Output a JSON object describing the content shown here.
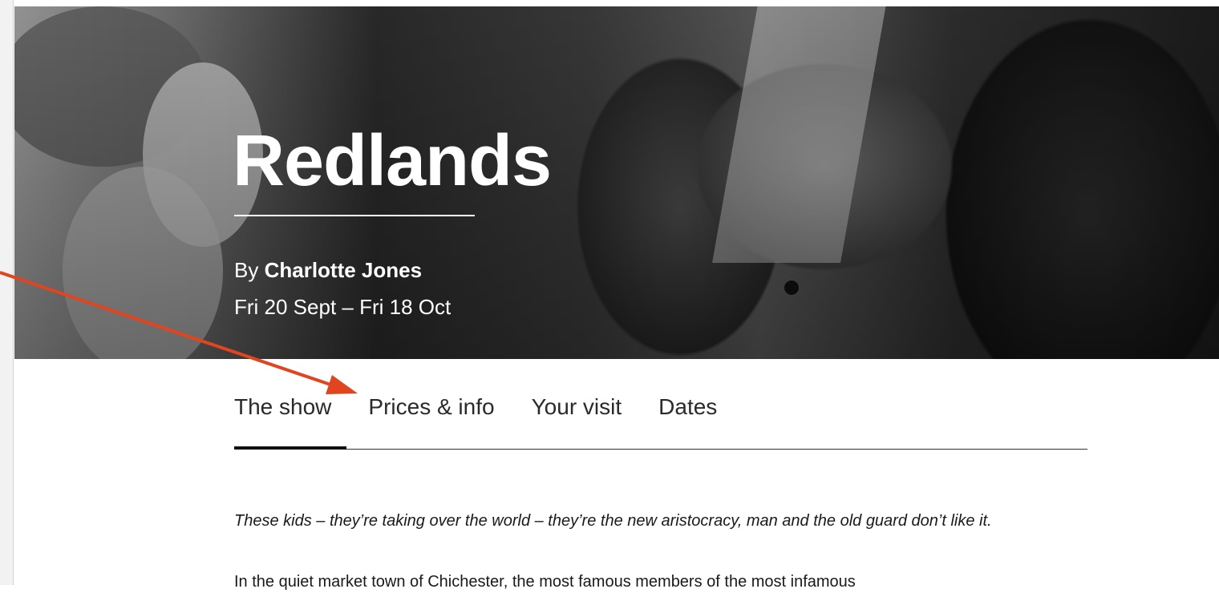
{
  "show": {
    "title": "Redlands",
    "by_prefix": "By ",
    "author": "Charlotte Jones",
    "dates": "Fri 20 Sept – Fri 18 Oct"
  },
  "tabs": [
    {
      "label": "The show",
      "active": true
    },
    {
      "label": "Prices & info",
      "active": false
    },
    {
      "label": "Your visit",
      "active": false
    },
    {
      "label": "Dates",
      "active": false
    }
  ],
  "content": {
    "quote": "These kids – they’re taking over the world – they’re the new aristocracy, man and the old guard don’t like it.",
    "paragraph": "In the quiet market town of Chichester, the most famous members of the most infamous"
  },
  "colors": {
    "annotation_arrow": "#e0451f",
    "active_tab_bar": "#111111"
  }
}
